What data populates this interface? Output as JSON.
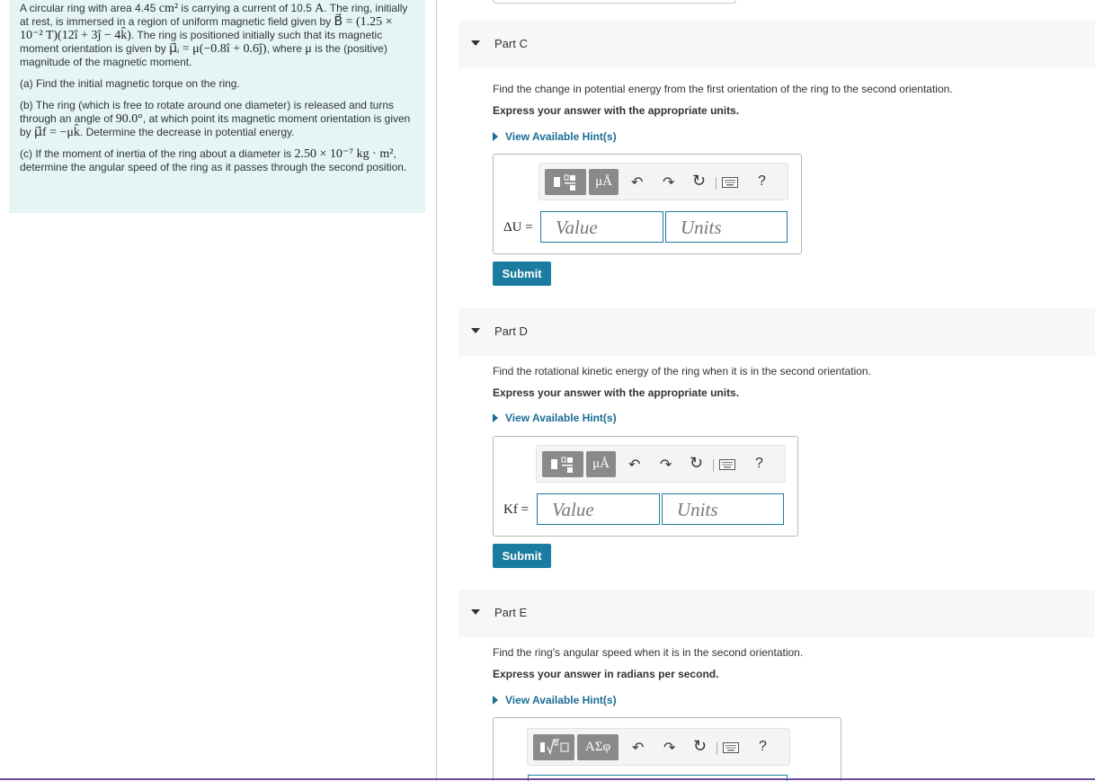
{
  "problem": {
    "intro_1": "A circular ring with area 4.45",
    "intro_area_unit": "cm²",
    "intro_2": "is carrying a current of 10.5",
    "intro_current_unit": "A",
    "intro_3": ". The ring, initially at rest, is immersed in a region of uniform magnetic field given by",
    "field_eq": "B⃗ = (1.25 × 10⁻² T)(12î + 3ĵ − 4k̂)",
    "intro_4": ". The ring is positioned initially such that its magnetic moment orientation is given by",
    "moment_i_eq": "μ⃗ᵢ = μ(−0.8î + 0.6ĵ)",
    "intro_5": ", where",
    "mu": "μ",
    "intro_6": "is the (positive) magnitude of the magnetic moment.",
    "part_a": "(a) Find the initial magnetic torque on the ring.",
    "part_b_1": "(b) The ring (which is free to rotate around one diameter) is released and turns through an angle of",
    "part_b_angle": "90.0°",
    "part_b_2": ", at which point its magnetic moment orientation is given by",
    "moment_f_eq": "μ⃗f = −μk̂",
    "part_b_3": ". Determine the decrease in potential energy.",
    "part_c_1": "(c) If the moment of inertia of the ring about a diameter is",
    "part_c_inertia": "2.50 × 10⁻⁷ kg · m²",
    "part_c_2": ", determine the angular speed of the ring as it passes through the second position."
  },
  "parts": [
    {
      "title": "Part C",
      "question": "Find the change in potential energy from the first orientation of the ring to the second orientation.",
      "instruction": "Express your answer with the appropriate units.",
      "hint": "View Available Hint(s)",
      "label": "ΔU =",
      "value_placeholder": "Value",
      "units_placeholder": "Units",
      "tool_template": "μÅ",
      "submit": "Submit"
    },
    {
      "title": "Part D",
      "question": "Find the rotational kinetic energy of the ring when it is in the second orientation.",
      "instruction": "Express your answer with the appropriate units.",
      "hint": "View Available Hint(s)",
      "label": "Kf =",
      "value_placeholder": "Value",
      "units_placeholder": "Units",
      "tool_template": "μÅ",
      "submit": "Submit"
    },
    {
      "title": "Part E",
      "question": "Find the ring's angular speed when it is in the second orientation.",
      "instruction": "Express your answer in radians per second.",
      "hint": "View Available Hint(s)",
      "tool_template": "ΑΣφ"
    }
  ],
  "toolbar": {
    "undo": "↶",
    "redo": "↷",
    "reset": "↻",
    "help": "?"
  },
  "colors": {
    "problem_bg": "#e5f5f5",
    "accent": "#1a7ca0",
    "hint_link": "#1a6d94",
    "bottom_rule": "#6b4aa0"
  }
}
